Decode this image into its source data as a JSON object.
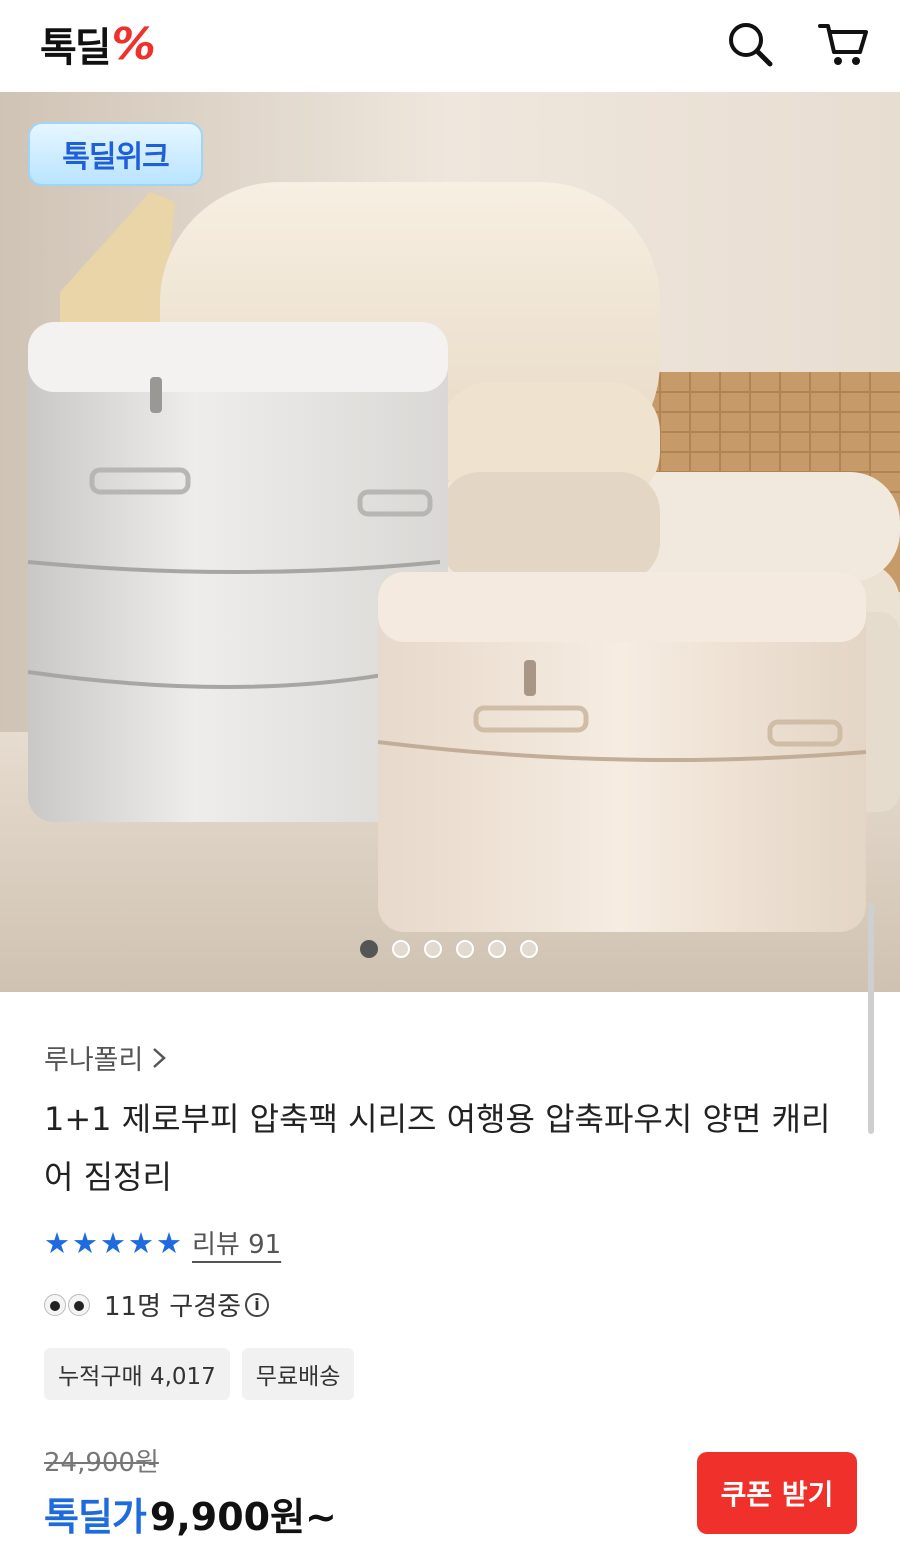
{
  "header": {
    "logo_text": "톡딜",
    "logo_symbol": "%",
    "search_icon": "search-icon",
    "cart_icon": "cart-icon"
  },
  "hero": {
    "badge": "톡딜위크",
    "image_count": 6,
    "active_index": 0
  },
  "product": {
    "brand": "루나폴리",
    "title": "1+1 제로부피 압축팩 시리즈 여행용 압축파우치 양면 캐리어 짐정리",
    "rating_stars": 5,
    "review_label": "리뷰 91",
    "viewers": "11명 구경중",
    "chips": [
      "누적구매 4,017",
      "무료배송"
    ],
    "original_price": "24,900원",
    "price_label": "톡딜가",
    "price": "9,900원~",
    "coupon_button": "쿠폰 받기"
  },
  "colors": {
    "accent_red": "#f0302a",
    "accent_blue": "#1e6bde"
  }
}
